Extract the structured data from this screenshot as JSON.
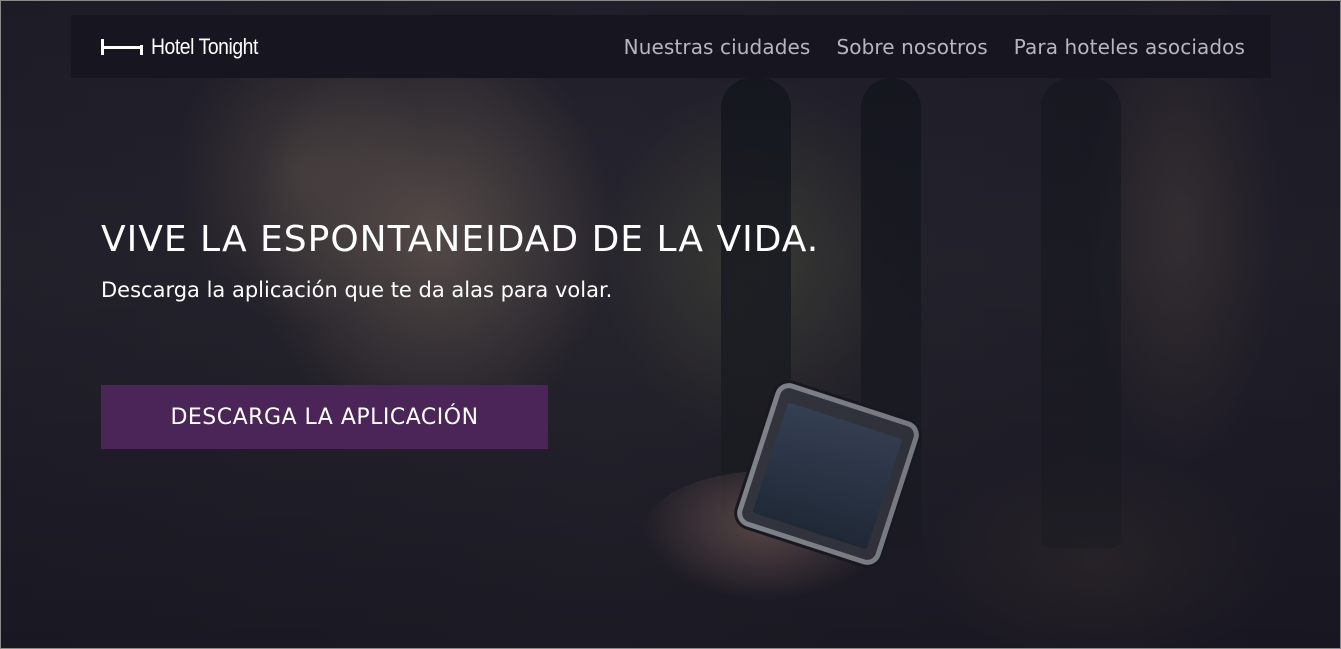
{
  "brand": {
    "name": "Hotel Tonight",
    "logo_icon": "bed-icon"
  },
  "nav": {
    "items": [
      {
        "label": "Nuestras ciudades"
      },
      {
        "label": "Sobre nosotros"
      },
      {
        "label": "Para hoteles asociados"
      }
    ]
  },
  "hero": {
    "headline": "VIVE LA ESPONTANEIDAD DE LA VIDA.",
    "subheadline": "Descarga la aplicación que te da alas para volar.",
    "cta_label": "DESCARGA LA APLICACIÓN",
    "background_image": "person-using-smartphone-photo"
  },
  "colors": {
    "navbar_bg": "#161520",
    "cta_bg": "#4b2557",
    "nav_text": "#b7b5c1",
    "hero_text": "#ffffff"
  }
}
